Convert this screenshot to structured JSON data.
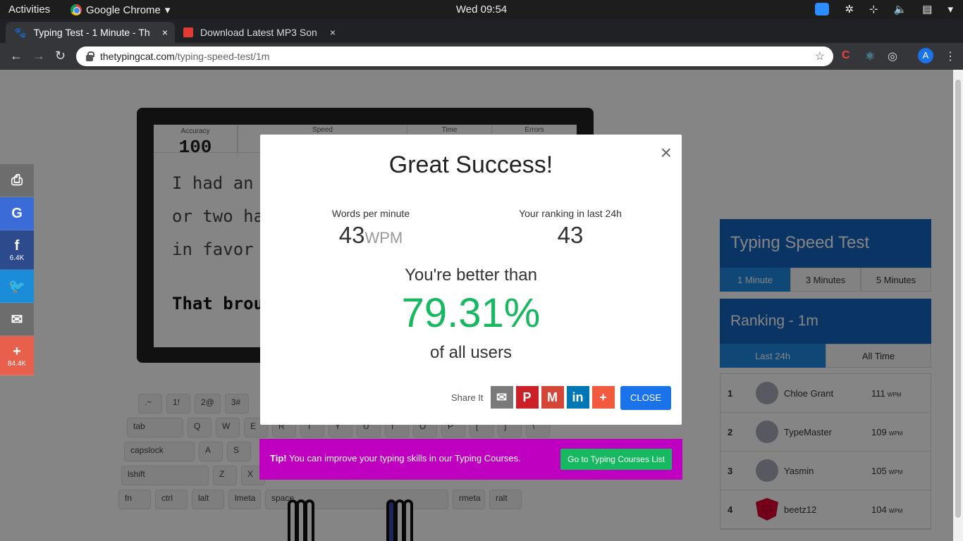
{
  "system": {
    "activities": "Activities",
    "app_name": "Google Chrome",
    "clock": "Wed 09:54"
  },
  "tabs": [
    {
      "title": "Typing Test - 1 Minute - Th",
      "close": "×"
    },
    {
      "title": "Download Latest MP3 Son",
      "close": "×"
    }
  ],
  "new_tab": "+",
  "omnibox": {
    "host": "thetypingcat.com",
    "path": "/typing-speed-test/1m"
  },
  "profile_initial": "A",
  "typing_area": {
    "stats": {
      "accuracy_label": "Accuracy",
      "accuracy_value": "100",
      "speed_label": "Speed",
      "time_label": "Time",
      "errors_label": "Errors"
    },
    "lines": [
      "I had an",
      "or two ha",
      "in favor"
    ],
    "bold_line": "That brou"
  },
  "keyboard": {
    "row1": [
      ".~",
      "1!",
      "2@",
      "3#"
    ],
    "row2": [
      "tab",
      "Q",
      "W",
      "E",
      "R",
      "T",
      "Y",
      "U",
      "I",
      "O",
      "P",
      "[",
      "]",
      "\\"
    ],
    "row3": [
      "capslock",
      "A",
      "S"
    ],
    "row4": [
      "lshift",
      "Z",
      "X"
    ],
    "row5": [
      "fn",
      "ctrl",
      "lalt",
      "lmeta",
      "space",
      "rmeta",
      "ralt"
    ]
  },
  "share_sidebar": {
    "facebook_count": "6.4K",
    "more_count": "84.4K"
  },
  "right_panel": {
    "title": "Typing Speed Test",
    "durations": [
      "1 Minute",
      "3 Minutes",
      "5 Minutes"
    ],
    "ranking_title": "Ranking - 1m",
    "ranking_tabs": [
      "Last 24h",
      "All Time"
    ],
    "rankings": [
      {
        "rank": "1",
        "name": "Chloe Grant",
        "wpm": "111",
        "unit": "WPM"
      },
      {
        "rank": "2",
        "name": "TypeMaster",
        "wpm": "109",
        "unit": "WPM"
      },
      {
        "rank": "3",
        "name": "Yasmin",
        "wpm": "105",
        "unit": "WPM"
      },
      {
        "rank": "4",
        "name": "beetz12",
        "wpm": "104",
        "unit": "WPM"
      }
    ]
  },
  "modal": {
    "title": "Great Success!",
    "wpm_label": "Words per minute",
    "wpm_value": "43",
    "wpm_unit": "WPM",
    "rank_label": "Your ranking in last 24h",
    "rank_value": "43",
    "better_than": "You're better than",
    "percent": "79.31%",
    "of_all": "of all users",
    "share_label": "Share It",
    "close_label": "CLOSE"
  },
  "tip": {
    "prefix": "Tip!",
    "text": " You can improve your typing skills in our Typing Courses.",
    "button": "Go to Typing Courses List"
  },
  "colors": {
    "modal_green": "#16b860",
    "brand_blue": "#1565c0",
    "tip_magenta": "#c000c0"
  }
}
